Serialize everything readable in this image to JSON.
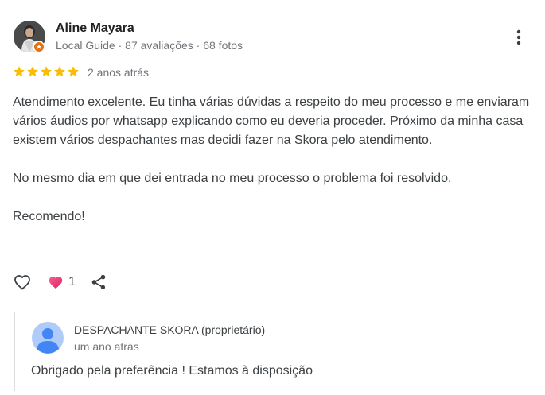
{
  "colors": {
    "star": "#fbbc04",
    "heart": "#ea4c89",
    "guide_badge": "#e8710a",
    "secondary_text": "#70757a"
  },
  "review": {
    "author": "Aline Mayara",
    "author_meta": "Local Guide · 87 avaliações · 68 fotos",
    "rating": 5,
    "time": "2 anos atrás",
    "paragraphs": [
      "Atendimento excelente. Eu tinha várias dúvidas a respeito do meu processo e me enviaram vários áudios por whatsapp explicando como eu deveria proceder. Próximo da minha casa existem vários despachantes mas decidi fazer na Skora pelo atendimento.",
      "No mesmo dia em que dei entrada no meu processo o problema foi resolvido.",
      "Recomendo!"
    ],
    "reaction_count": "1"
  },
  "icons": {
    "menu": "more-vert-icon",
    "like": "heart-outline-icon",
    "reaction": "heart-filled-icon",
    "share": "share-icon",
    "badge": "local-guide-star-icon"
  },
  "owner_reply": {
    "owner": "DESPACHANTE SKORA (proprietário)",
    "time": "um ano atrás",
    "text": "Obrigado pela preferência ! Estamos à disposição"
  }
}
